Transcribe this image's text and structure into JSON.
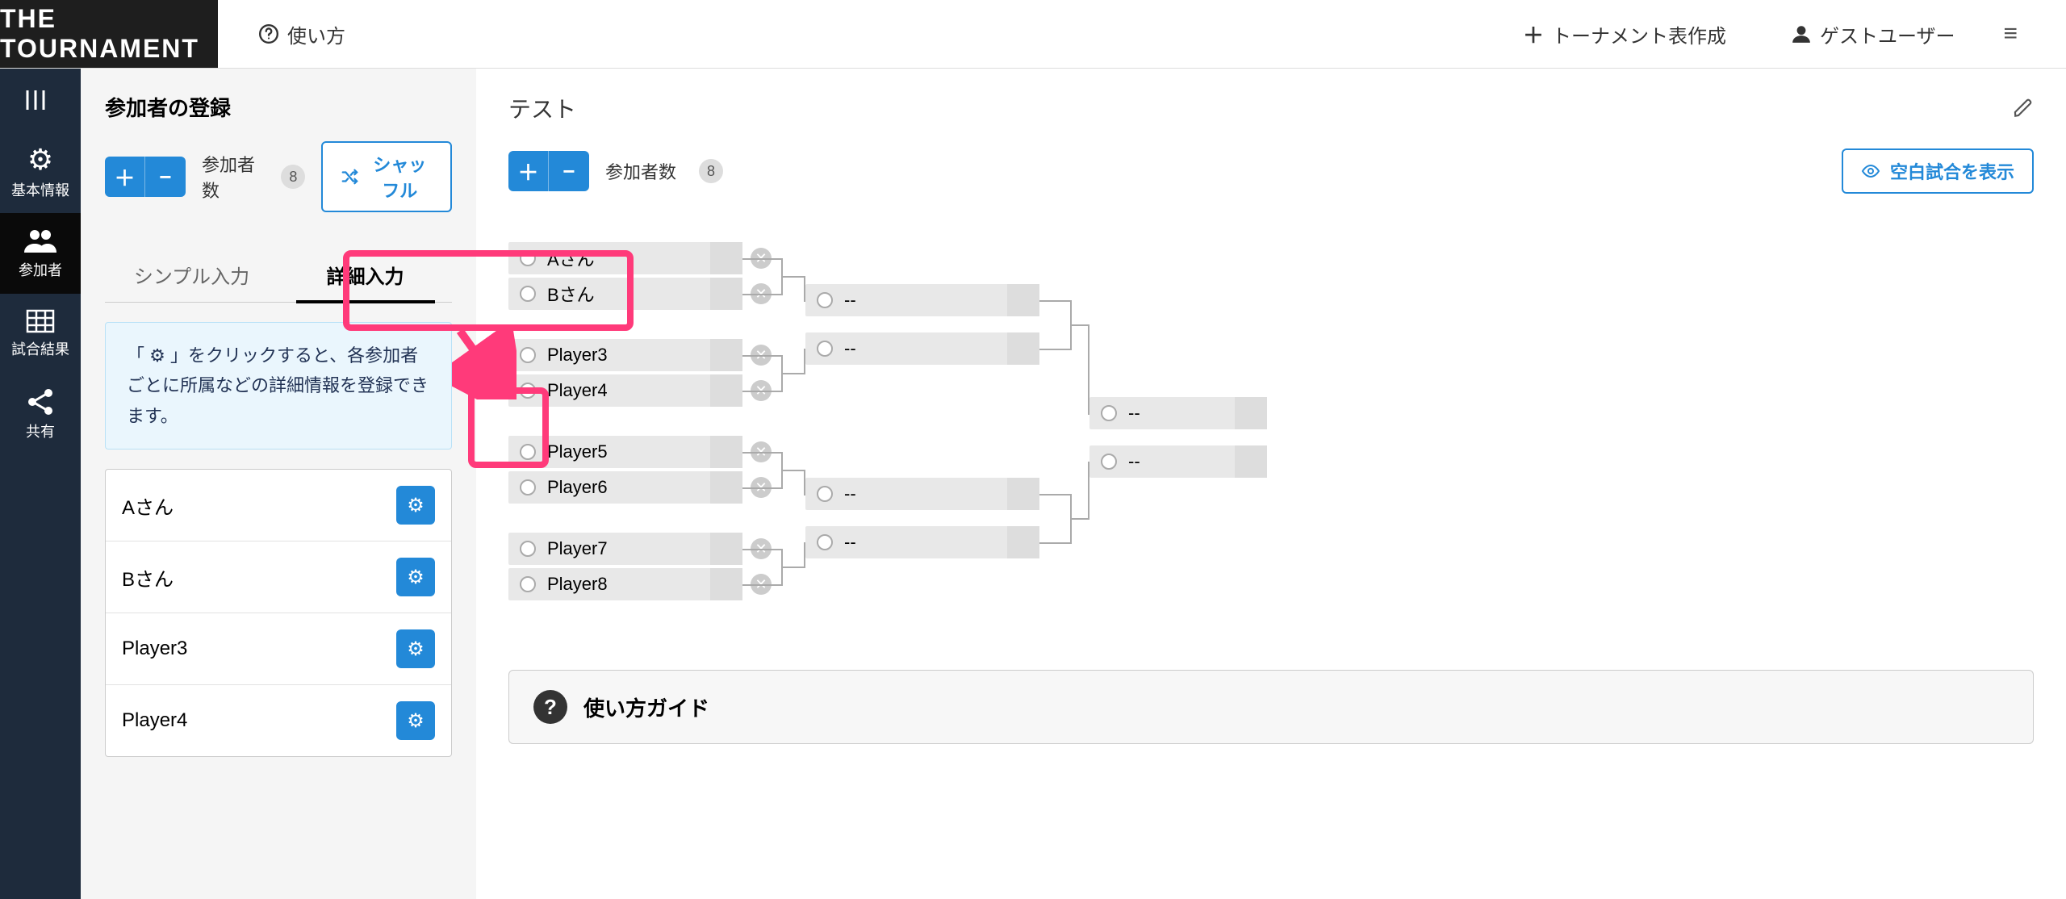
{
  "header": {
    "logo": "THE TOURNAMENT",
    "usage_link": "使い方",
    "create_link": "トーナメント表作成",
    "user_link": "ゲストユーザー"
  },
  "sidebar": {
    "items": [
      {
        "label": "基本情報"
      },
      {
        "label": "参加者"
      },
      {
        "label": "試合結果"
      },
      {
        "label": "共有"
      }
    ]
  },
  "left": {
    "title": "参加者の登録",
    "count_label": "参加者数",
    "count": "8",
    "shuffle": "シャッフル",
    "tabs": {
      "simple": "シンプル入力",
      "detail": "詳細入力"
    },
    "info_text": "「 ⚙ 」をクリックすると、各参加者ごとに所属などの詳細情報を登録できます。",
    "players": [
      {
        "name": "Aさん"
      },
      {
        "name": "Bさん"
      },
      {
        "name": "Player3"
      },
      {
        "name": "Player4"
      }
    ]
  },
  "right": {
    "title": "テスト",
    "count_label": "参加者数",
    "count": "8",
    "show_blank": "空白試合を表示",
    "guide_title": "使い方ガイド",
    "round1": [
      "Aさん",
      "Bさん",
      "Player3",
      "Player4",
      "Player5",
      "Player6",
      "Player7",
      "Player8"
    ],
    "placeholder": "--"
  }
}
